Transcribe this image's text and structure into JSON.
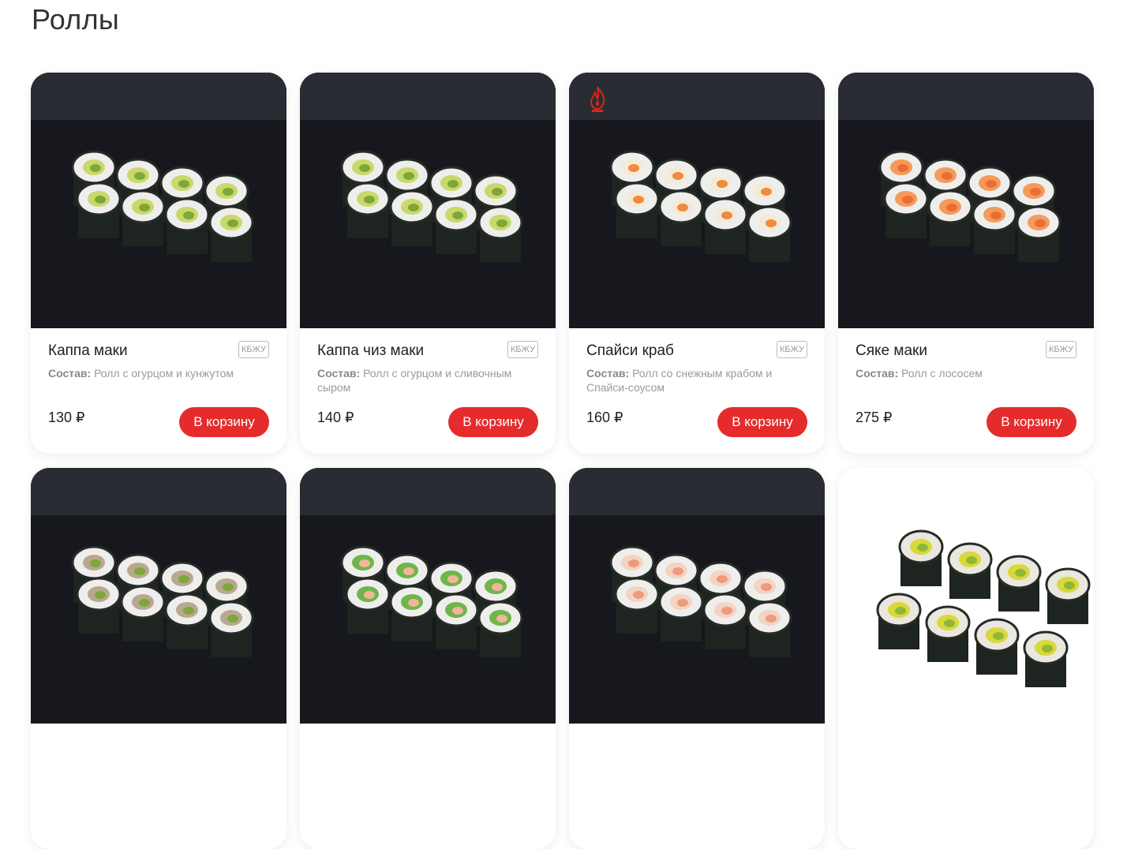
{
  "page": {
    "title": "Роллы"
  },
  "colors": {
    "accent": "#e52b2b",
    "card_bg": "#ffffff",
    "photo_bg": "#15171c"
  },
  "products": [
    {
      "name": "Каппа маки",
      "kbju_label": "КБЖУ",
      "composition_label": "Состав:",
      "composition": " Ролл с огурцом и кунжутом",
      "price": "130 ₽",
      "button": "В корзину",
      "filling": "cucumber",
      "hot": false
    },
    {
      "name": "Каппа чиз маки",
      "kbju_label": "КБЖУ",
      "composition_label": "Состав:",
      "composition": " Ролл с огурцом и сливочным сыром",
      "price": "140 ₽",
      "button": "В корзину",
      "filling": "cucumber",
      "hot": false
    },
    {
      "name": "Спайси краб",
      "kbju_label": "КБЖУ",
      "composition_label": "Состав:",
      "composition": " Ролл со снежным крабом и Спайси-соусом",
      "price": "160 ₽",
      "button": "В корзину",
      "filling": "crab",
      "hot": true,
      "hot_icon": "flame-hot-icon"
    },
    {
      "name": "Сяке маки",
      "kbju_label": "КБЖУ",
      "composition_label": "Состав:",
      "composition": " Ролл с лососем",
      "price": "275 ₽",
      "button": "В корзину",
      "filling": "salmon",
      "hot": false
    },
    {
      "filling": "eel-cucumber"
    },
    {
      "filling": "greens-sauce"
    },
    {
      "filling": "shrimp"
    },
    {
      "filling": "avocado"
    }
  ]
}
